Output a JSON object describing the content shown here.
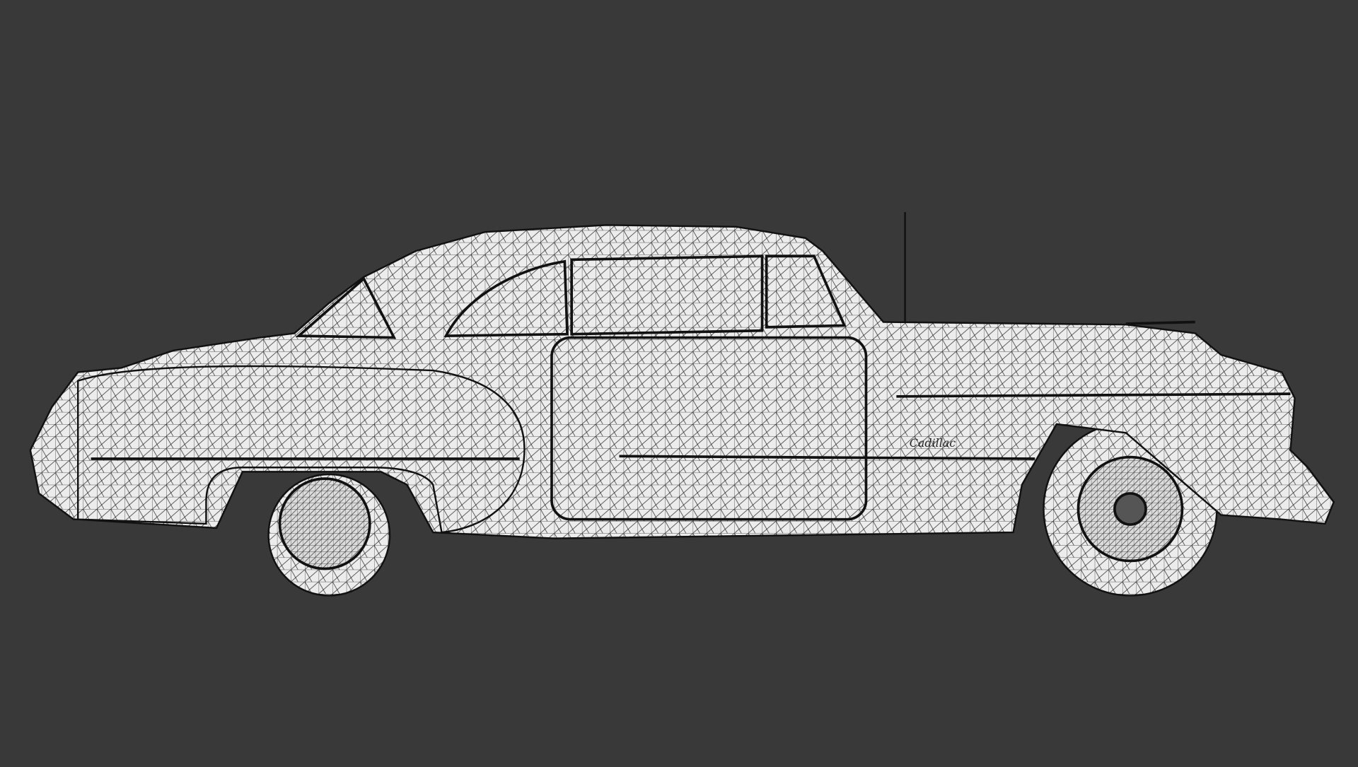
{
  "scene": {
    "subject": "wireframe-car-render",
    "badge_text": "Cadillac"
  },
  "colors": {
    "background": "#393939",
    "surface": "#ececec",
    "wire": "#1a1a1a"
  }
}
